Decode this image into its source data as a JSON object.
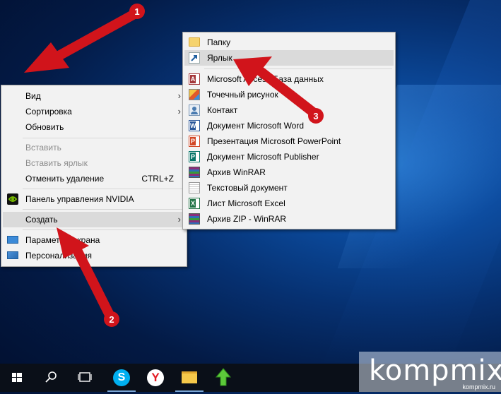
{
  "desktop_menu": {
    "items": [
      {
        "label": "Вид"
      },
      {
        "label": "Сортировка"
      },
      {
        "label": "Обновить"
      },
      {
        "label": "Вставить"
      },
      {
        "label": "Вставить ярлык"
      },
      {
        "label": "Отменить удаление",
        "shortcut": "CTRL+Z"
      },
      {
        "label": "Панель управления NVIDIA"
      },
      {
        "label": "Создать"
      },
      {
        "label": "Параметры экрана"
      },
      {
        "label": "Персонализация"
      }
    ]
  },
  "create_submenu": {
    "items": [
      {
        "label": "Папку"
      },
      {
        "label": "Ярлык"
      },
      {
        "label": "Microsoft Access База данных"
      },
      {
        "label": "Точечный рисунок"
      },
      {
        "label": "Контакт"
      },
      {
        "label": "Документ Microsoft Word"
      },
      {
        "label": "Презентация Microsoft PowerPoint"
      },
      {
        "label": "Документ Microsoft Publisher"
      },
      {
        "label": "Архив WinRAR"
      },
      {
        "label": "Текстовый документ"
      },
      {
        "label": "Лист Microsoft Excel"
      },
      {
        "label": "Архив ZIP - WinRAR"
      }
    ]
  },
  "annotations": {
    "step1": "1",
    "step2": "2",
    "step3": "3"
  },
  "watermark": {
    "text": "kompmix",
    "small": "kompmix.ru"
  },
  "taskbar": {
    "icons": [
      "windows-start-icon",
      "search-icon",
      "task-view-icon",
      "skype-icon",
      "yandex-browser-icon",
      "file-explorer-icon",
      "upload-icon"
    ]
  },
  "colors": {
    "arrow_red": "#d1141b",
    "menu_bg": "#f2f2f2",
    "highlight": "#dadada"
  }
}
